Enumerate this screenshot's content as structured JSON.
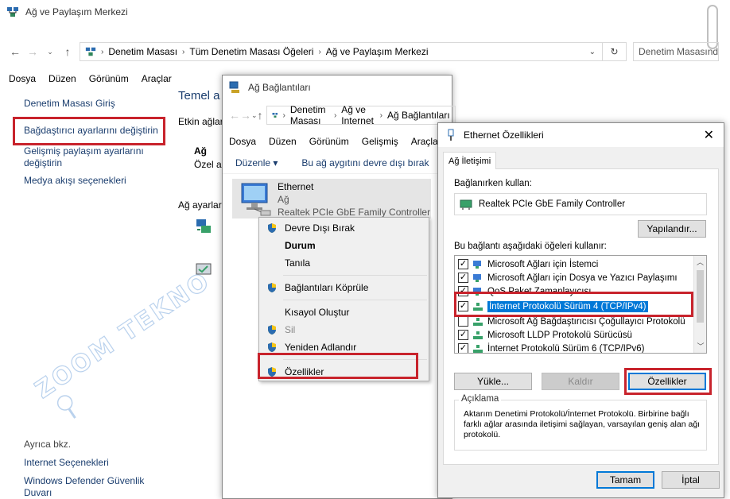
{
  "main_window": {
    "title": "Ağ ve Paylaşım Merkezi",
    "breadcrumb": [
      "Denetim Masası",
      "Tüm Denetim Masası Öğeleri",
      "Ağ ve Paylaşım Merkezi"
    ],
    "search_placeholder": "Denetim Masasınd",
    "menu": [
      "Dosya",
      "Düzen",
      "Görünüm",
      "Araçlar"
    ],
    "sidebar": {
      "items": [
        "Denetim Masası Giriş",
        "Bağdaştırıcı ayarlarını değiştirin",
        "Gelişmiş paylaşım ayarlarını değiştirin",
        "Medya akışı seçenekleri"
      ],
      "see_also_title": "Ayrıca bkz.",
      "see_also": [
        "Internet Seçenekleri",
        "Windows Defender Güvenlik Duvarı"
      ]
    },
    "content": {
      "heading": "Temel a",
      "active_label": "Etkin ağlar",
      "network_name": "Ağ",
      "network_type": "Özel a",
      "settings_label": "Ağ ayarları"
    }
  },
  "connections_window": {
    "title": "Ağ Bağlantıları",
    "breadcrumb": [
      "Denetim Masası",
      "Ağ ve Internet",
      "Ağ Bağlantıları"
    ],
    "menu": [
      "Dosya",
      "Düzen",
      "Görünüm",
      "Gelişmiş",
      "Araçla"
    ],
    "toolbar": {
      "organize": "Düzenle",
      "disable": "Bu ağ aygıtını devre dışı bırak"
    },
    "adapter": {
      "name": "Ethernet",
      "status": "Ağ",
      "device": "Realtek PCIe GbE Family Controller"
    }
  },
  "context_menu": {
    "items": [
      {
        "label": "Devre Dışı Bırak",
        "shield": true,
        "bold": false,
        "disabled": false
      },
      {
        "label": "Durum",
        "shield": false,
        "bold": true,
        "disabled": false
      },
      {
        "label": "Tanıla",
        "shield": false,
        "bold": false,
        "disabled": false
      },
      {
        "label": "Bağlantıları Köprüle",
        "shield": true,
        "bold": false,
        "disabled": false
      },
      {
        "label": "Kısayol Oluştur",
        "shield": false,
        "bold": false,
        "disabled": false
      },
      {
        "label": "Sil",
        "shield": true,
        "bold": false,
        "disabled": true
      },
      {
        "label": "Yeniden Adlandır",
        "shield": true,
        "bold": false,
        "disabled": false
      },
      {
        "label": "Özellikler",
        "shield": true,
        "bold": false,
        "disabled": false
      }
    ]
  },
  "properties_dialog": {
    "title": "Ethernet Özellikleri",
    "tab": "Ağ İletişimi",
    "connect_using_label": "Bağlanırken kullan:",
    "adapter_name": "Realtek PCIe GbE Family Controller",
    "configure_button": "Yapılandır...",
    "items_label": "Bu bağlantı aşağıdaki öğeleri kullanır:",
    "items": [
      {
        "label": "Microsoft Ağları için İstemci",
        "checked": true,
        "selected": false
      },
      {
        "label": "Microsoft Ağları için Dosya ve Yazıcı Paylaşımı",
        "checked": true,
        "selected": false
      },
      {
        "label": "QoS Paket Zamanlayıcısı",
        "checked": true,
        "selected": false
      },
      {
        "label": "İnternet Protokolü Sürüm 4 (TCP/IPv4)",
        "checked": true,
        "selected": true
      },
      {
        "label": "Microsoft Ağ Bağdaştırıcısı Çoğullayıcı Protokolü",
        "checked": false,
        "selected": false
      },
      {
        "label": "Microsoft LLDP Protokolü Sürücüsü",
        "checked": true,
        "selected": false
      },
      {
        "label": "İnternet Protokolü Sürüm 6 (TCP/IPv6)",
        "checked": true,
        "selected": false
      }
    ],
    "install_button": "Yükle...",
    "uninstall_button": "Kaldır",
    "properties_button": "Özellikler",
    "description_title": "Açıklama",
    "description_text": "Aktarım Denetimi Protokolü/İnternet Protokolü. Birbirine bağlı farklı ağlar arasında iletişimi sağlayan, varsayılan geniş alan ağı protokolü.",
    "ok_button": "Tamam",
    "cancel_button": "İptal"
  },
  "watermark": "ZOOM TEKNO .com",
  "colors": {
    "highlight_red": "#c8232c",
    "selection_blue": "#0078d7",
    "link_blue": "#1a3d6e"
  }
}
